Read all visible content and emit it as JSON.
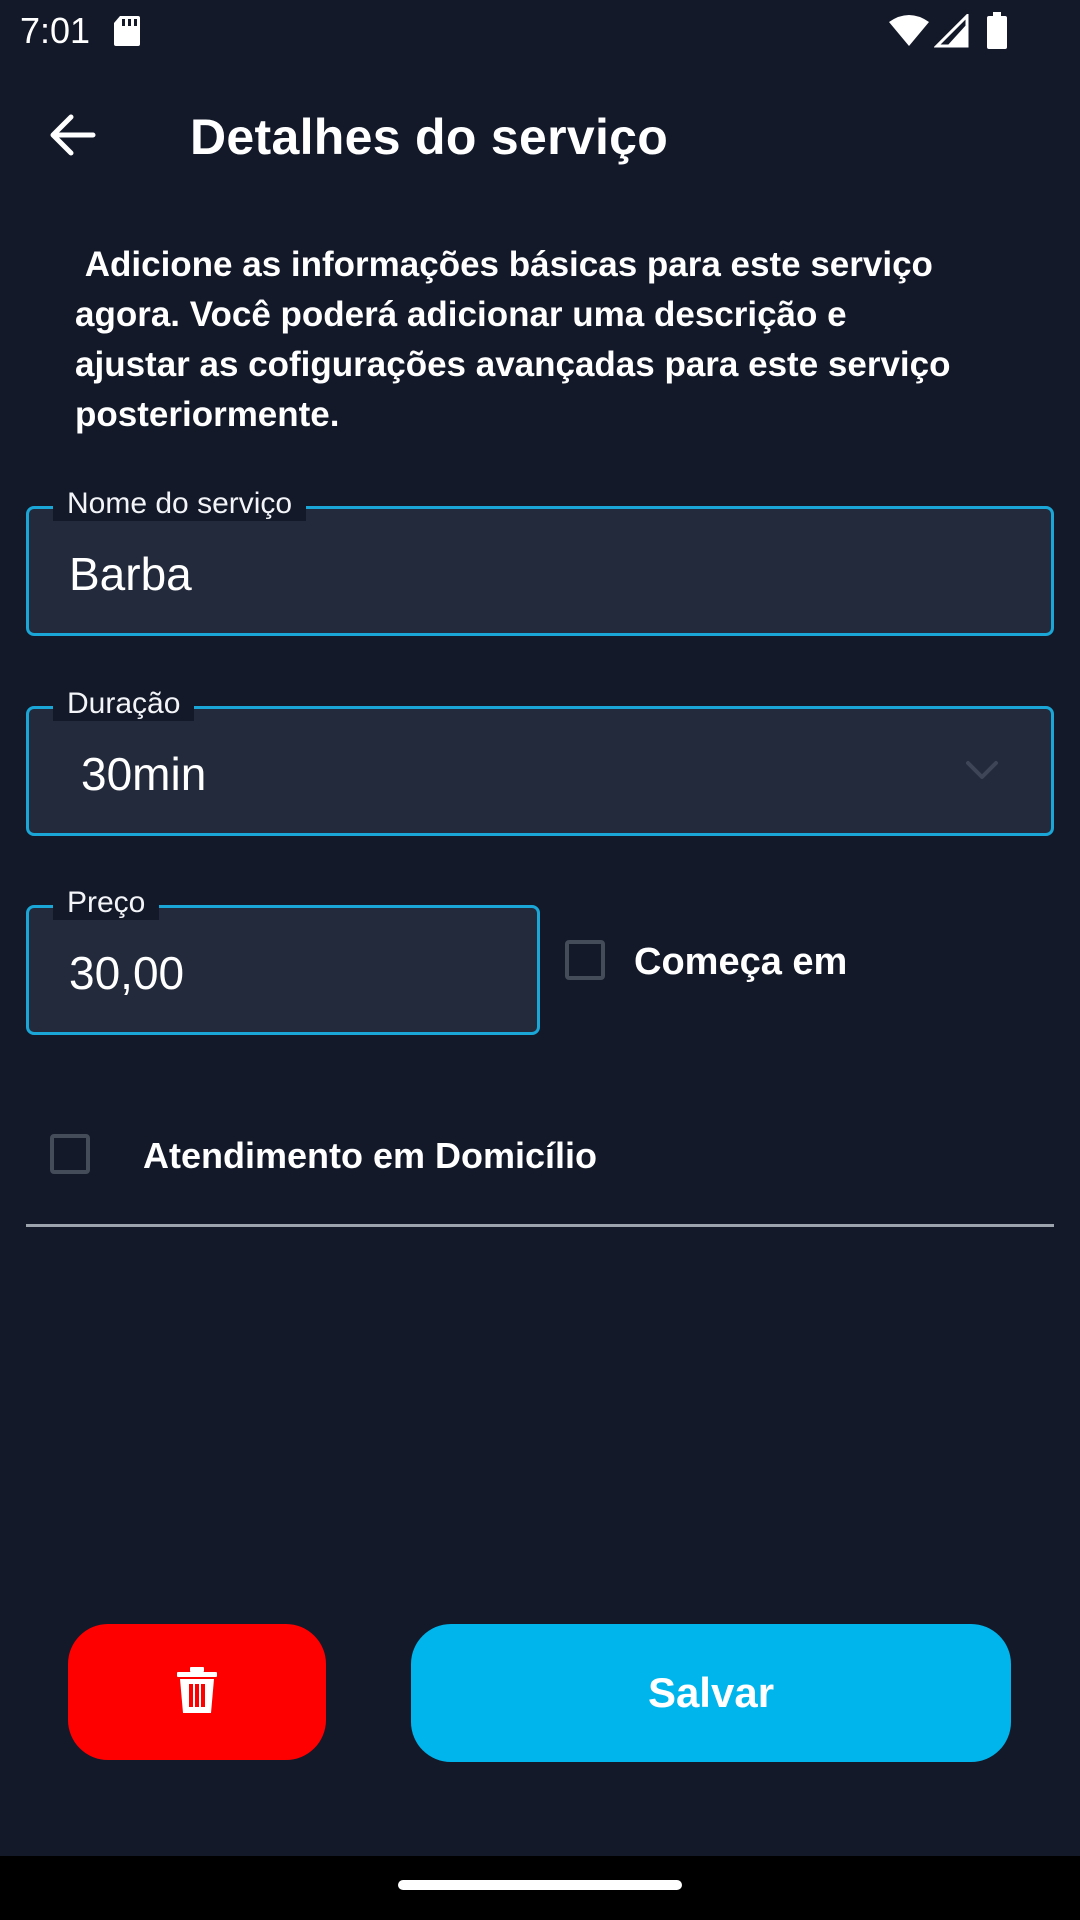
{
  "status_bar": {
    "time": "7:01",
    "icons": [
      "sd-card-icon",
      "wifi-icon",
      "signal-icon",
      "battery-icon"
    ]
  },
  "header": {
    "back_icon": "arrow-left-icon",
    "title": "Detalhes do serviço"
  },
  "intro": {
    "text": " Adicione as informações básicas para este serviço\nagora. Você poderá adicionar uma descrição e\najustar as cofigurações avançadas para este serviço\nposteriormente."
  },
  "form": {
    "name": {
      "label": "Nome do serviço",
      "value": "Barba"
    },
    "duration": {
      "label": "Duração",
      "value": "30min"
    },
    "price": {
      "label": "Preço",
      "value": "30,00"
    },
    "starts_at": {
      "label": "Começa em",
      "checked": false
    },
    "home_service": {
      "label": "Atendimento em Domicílio",
      "checked": false
    }
  },
  "actions": {
    "delete_icon": "trash-icon",
    "save_label": "Salvar"
  },
  "colors": {
    "background": "#131929",
    "field_background": "#232a3b",
    "field_border": "#1aa6d6",
    "delete": "#ff0000",
    "save": "#00b5ec"
  }
}
